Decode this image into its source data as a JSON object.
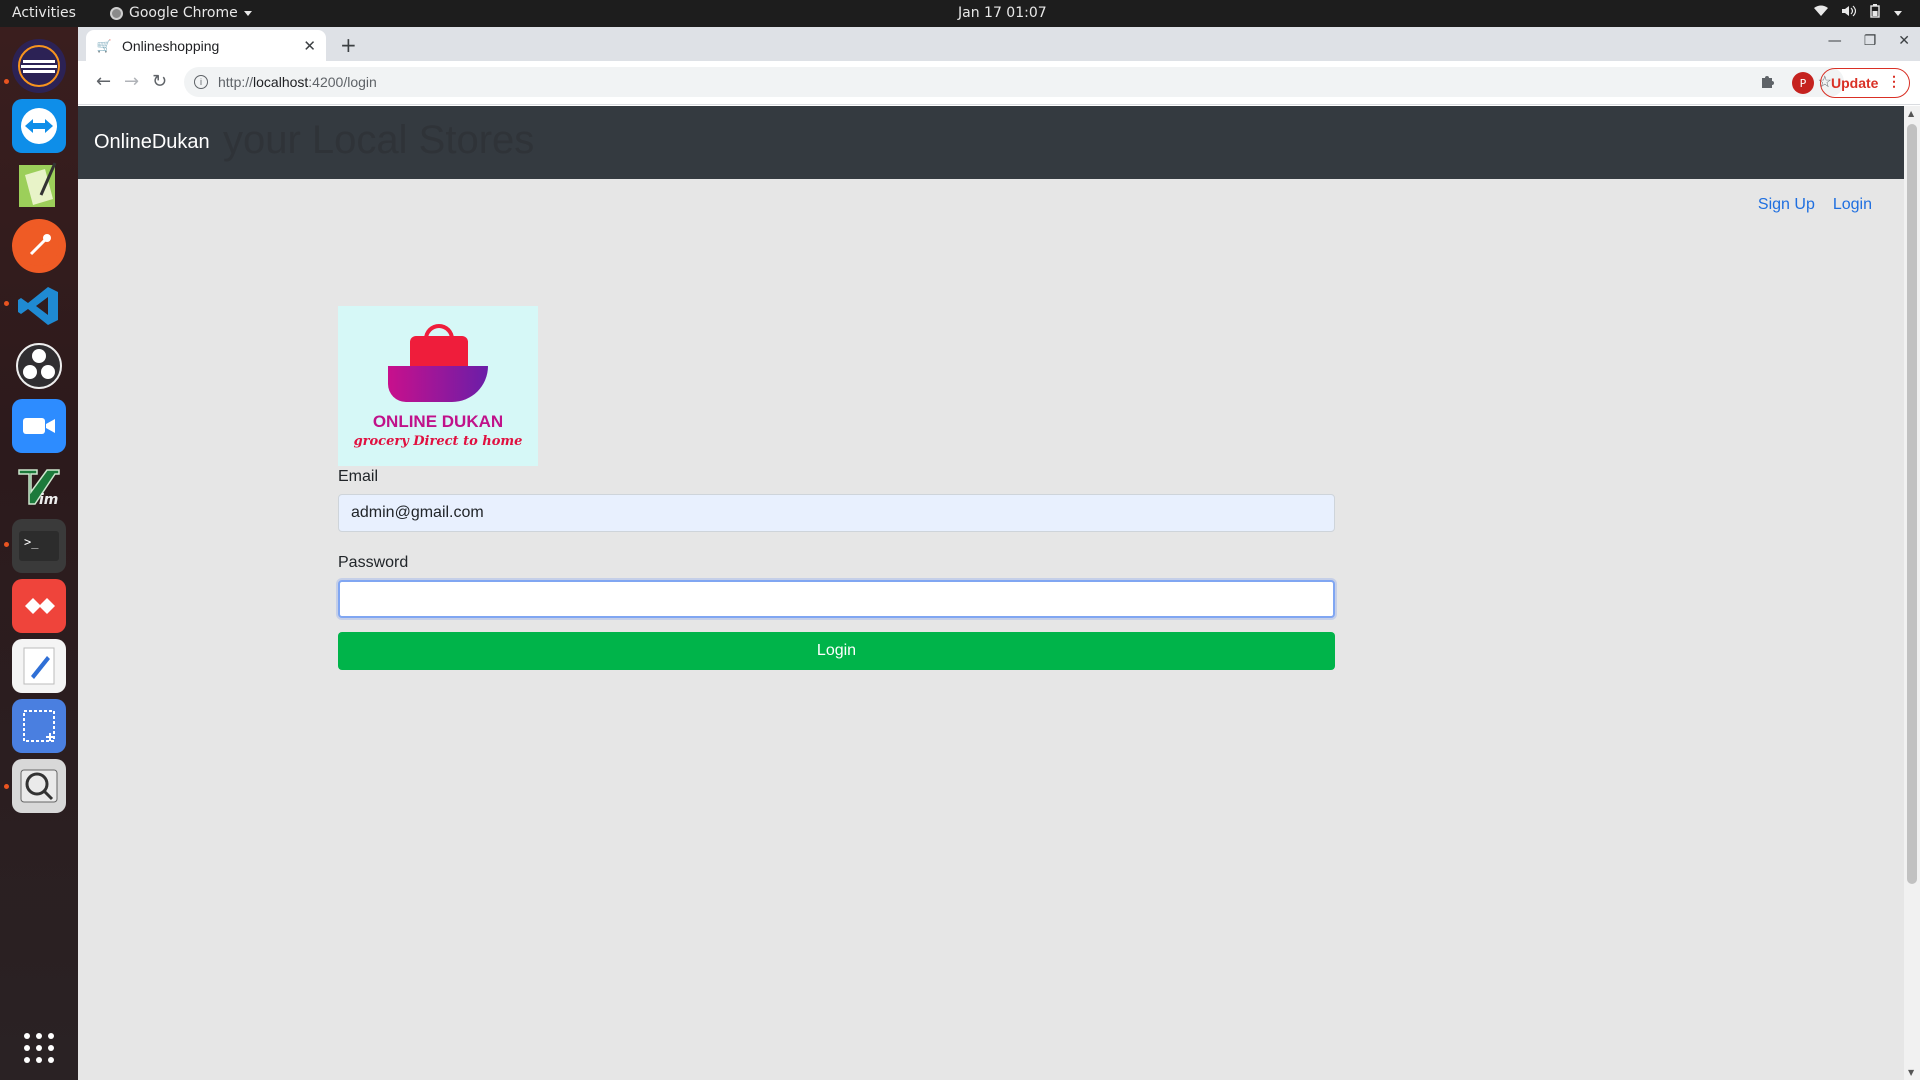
{
  "system": {
    "activities": "Activities",
    "app_menu": "Google Chrome",
    "clock": "Jan 17  01:07"
  },
  "dock": {
    "items": [
      {
        "name": "eclipse-icon",
        "color": "#2c2255"
      },
      {
        "name": "teamviewer-icon",
        "color": "#0e8ee9"
      },
      {
        "name": "gedit-icon",
        "color": "#4a8a3a"
      },
      {
        "name": "postman-icon",
        "color": "#ef5b25"
      },
      {
        "name": "vscode-icon",
        "color": "#1f8ad2"
      },
      {
        "name": "obs-icon",
        "color": "#302e31"
      },
      {
        "name": "zoom-icon",
        "color": "#2d8cff"
      },
      {
        "name": "vim-icon",
        "color": "#1c7a3b"
      },
      {
        "name": "terminal-icon",
        "color": "#3a3a3a"
      },
      {
        "name": "anydesk-icon",
        "color": "#ef443b"
      },
      {
        "name": "text-editor-icon",
        "color": "#f4f4f4"
      },
      {
        "name": "screenshot-icon",
        "color": "#4a7fe0"
      },
      {
        "name": "magnifier-icon",
        "color": "#d8d8d8"
      },
      {
        "name": "show-apps-icon",
        "color": "#2a2224"
      }
    ]
  },
  "browser": {
    "tab_title": "Onlineshopping",
    "url_prefix": "http://",
    "url_host": "localhost",
    "url_path": ":4200/login",
    "profile_initial": "P",
    "update_label": "Update"
  },
  "site": {
    "brand": "OnlineDukan",
    "tagline": "your Local Stores",
    "nav_links": [
      "Sign Up",
      "Login"
    ],
    "logo_line1": "ONLINE DUKAN",
    "logo_line2": "grocery Direct to home"
  },
  "form": {
    "email_label": "Email",
    "email_value": "admin@gmail.com",
    "password_label": "Password",
    "password_value": "",
    "submit_label": "Login"
  }
}
